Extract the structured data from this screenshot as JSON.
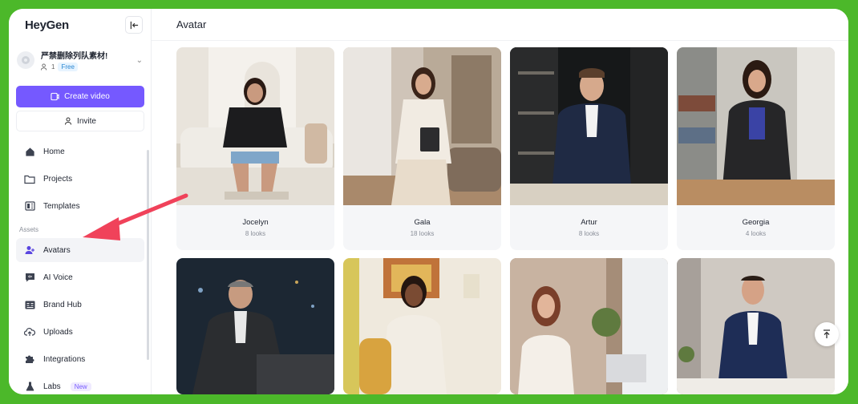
{
  "app": {
    "logo": "HeyGen"
  },
  "workspace": {
    "name": "严禁删除列队素材!",
    "members": "1",
    "plan": "Free"
  },
  "sidebar": {
    "create_label": "Create video",
    "invite_label": "Invite",
    "items": [
      {
        "label": "Home",
        "icon": "home-icon"
      },
      {
        "label": "Projects",
        "icon": "folder-icon"
      },
      {
        "label": "Templates",
        "icon": "templates-icon"
      }
    ],
    "assets_label": "Assets",
    "asset_items": [
      {
        "label": "Avatars",
        "icon": "avatar-icon",
        "active": true
      },
      {
        "label": "AI Voice",
        "icon": "voice-icon"
      },
      {
        "label": "Brand Hub",
        "icon": "brand-icon"
      },
      {
        "label": "Uploads",
        "icon": "upload-icon"
      },
      {
        "label": "Integrations",
        "icon": "puzzle-icon"
      },
      {
        "label": "Labs",
        "icon": "flask-icon",
        "badge": "New"
      }
    ]
  },
  "main": {
    "title": "Avatar",
    "avatars": [
      {
        "name": "Jocelyn",
        "looks": "8 looks"
      },
      {
        "name": "Gala",
        "looks": "18 looks"
      },
      {
        "name": "Artur",
        "looks": "8 looks"
      },
      {
        "name": "Georgia",
        "looks": "4 looks"
      }
    ]
  },
  "colors": {
    "accent": "#7559ff",
    "frame": "#4cb82a",
    "annotation_arrow": "#f0425a"
  }
}
